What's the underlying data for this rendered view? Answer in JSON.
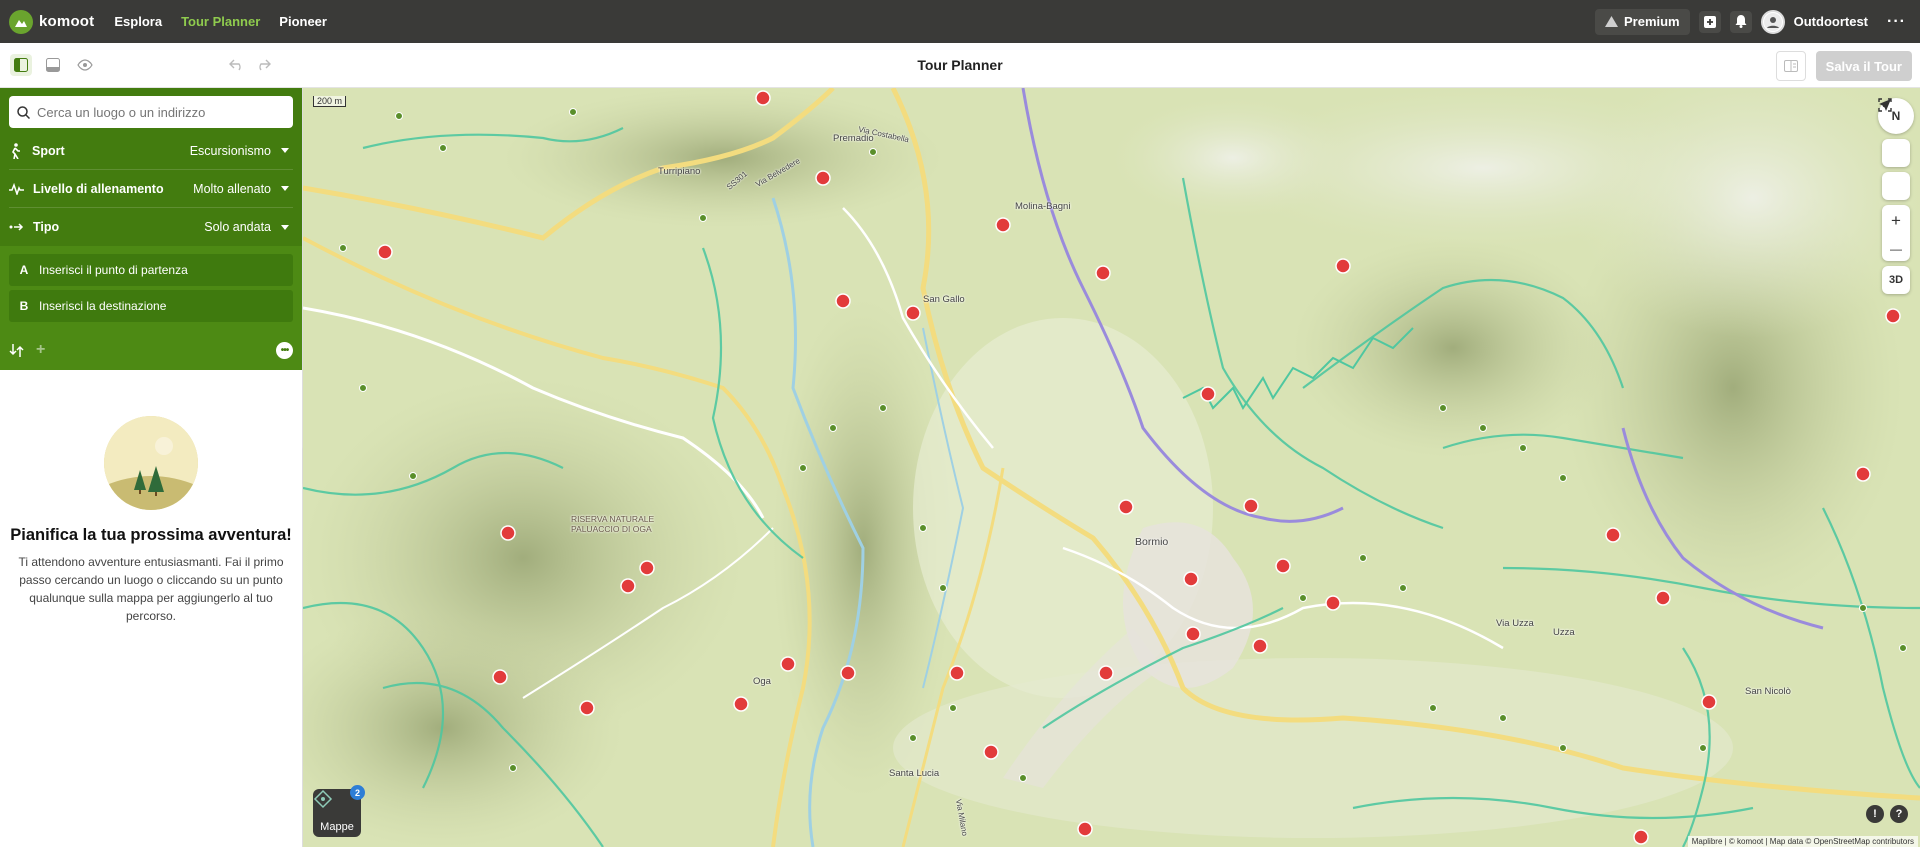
{
  "topbar": {
    "brand": "komoot",
    "nav": [
      "Esplora",
      "Tour Planner",
      "Pioneer"
    ],
    "premium_label": "Premium",
    "username": "Outdoortest",
    "more": "···"
  },
  "toolbar": {
    "title": "Tour Planner",
    "save_label": "Salva il Tour"
  },
  "sidebar": {
    "search_placeholder": "Cerca un luogo o un indirizzo",
    "options": [
      {
        "label": "Sport",
        "value": "Escursionismo"
      },
      {
        "label": "Livello di allenamento",
        "value": "Molto allenato"
      },
      {
        "label": "Tipo",
        "value": "Solo andata"
      }
    ],
    "waypoints": [
      {
        "letter": "A",
        "text": "Inserisci il punto di partenza"
      },
      {
        "letter": "B",
        "text": "Inserisci la destinazione"
      }
    ],
    "add_symbol": "+",
    "empty_title": "Pianifica la tua prossima avventura!",
    "empty_text": "Ti attendono avventure entusiasmanti. Fai il primo passo cercando un luogo o cliccando su un punto qualunque sulla mappa per aggiungerlo al tuo percorso."
  },
  "map": {
    "scale": "200 m",
    "compass": "N",
    "zoom_in": "+",
    "zoom_out": "—",
    "btn_3d": "3D",
    "maps_label": "Mappe",
    "maps_badge": "2",
    "attribution": "Maplibre | © komoot | Map data © OpenStreetMap contributors",
    "places": [
      {
        "name": "Premadio"
      },
      {
        "name": "Turripiano"
      },
      {
        "name": "Molina-Bagni"
      },
      {
        "name": "San Gallo"
      },
      {
        "name": "Bormio"
      },
      {
        "name": "RISERVA NATURALE"
      },
      {
        "name": "PALUACCIO DI OGA"
      },
      {
        "name": "Oga"
      },
      {
        "name": "Santa Lucia"
      },
      {
        "name": "Uzza"
      },
      {
        "name": "Via Uzza"
      },
      {
        "name": "San Nicolò"
      },
      {
        "name": "Via Costabella"
      },
      {
        "name": "Via Belvedere"
      },
      {
        "name": "SS301"
      },
      {
        "name": "Via Milano"
      }
    ]
  },
  "colors": {
    "accent": "#437c0f",
    "nav_active": "#8fcb4e",
    "topbar": "#3a3a38"
  }
}
